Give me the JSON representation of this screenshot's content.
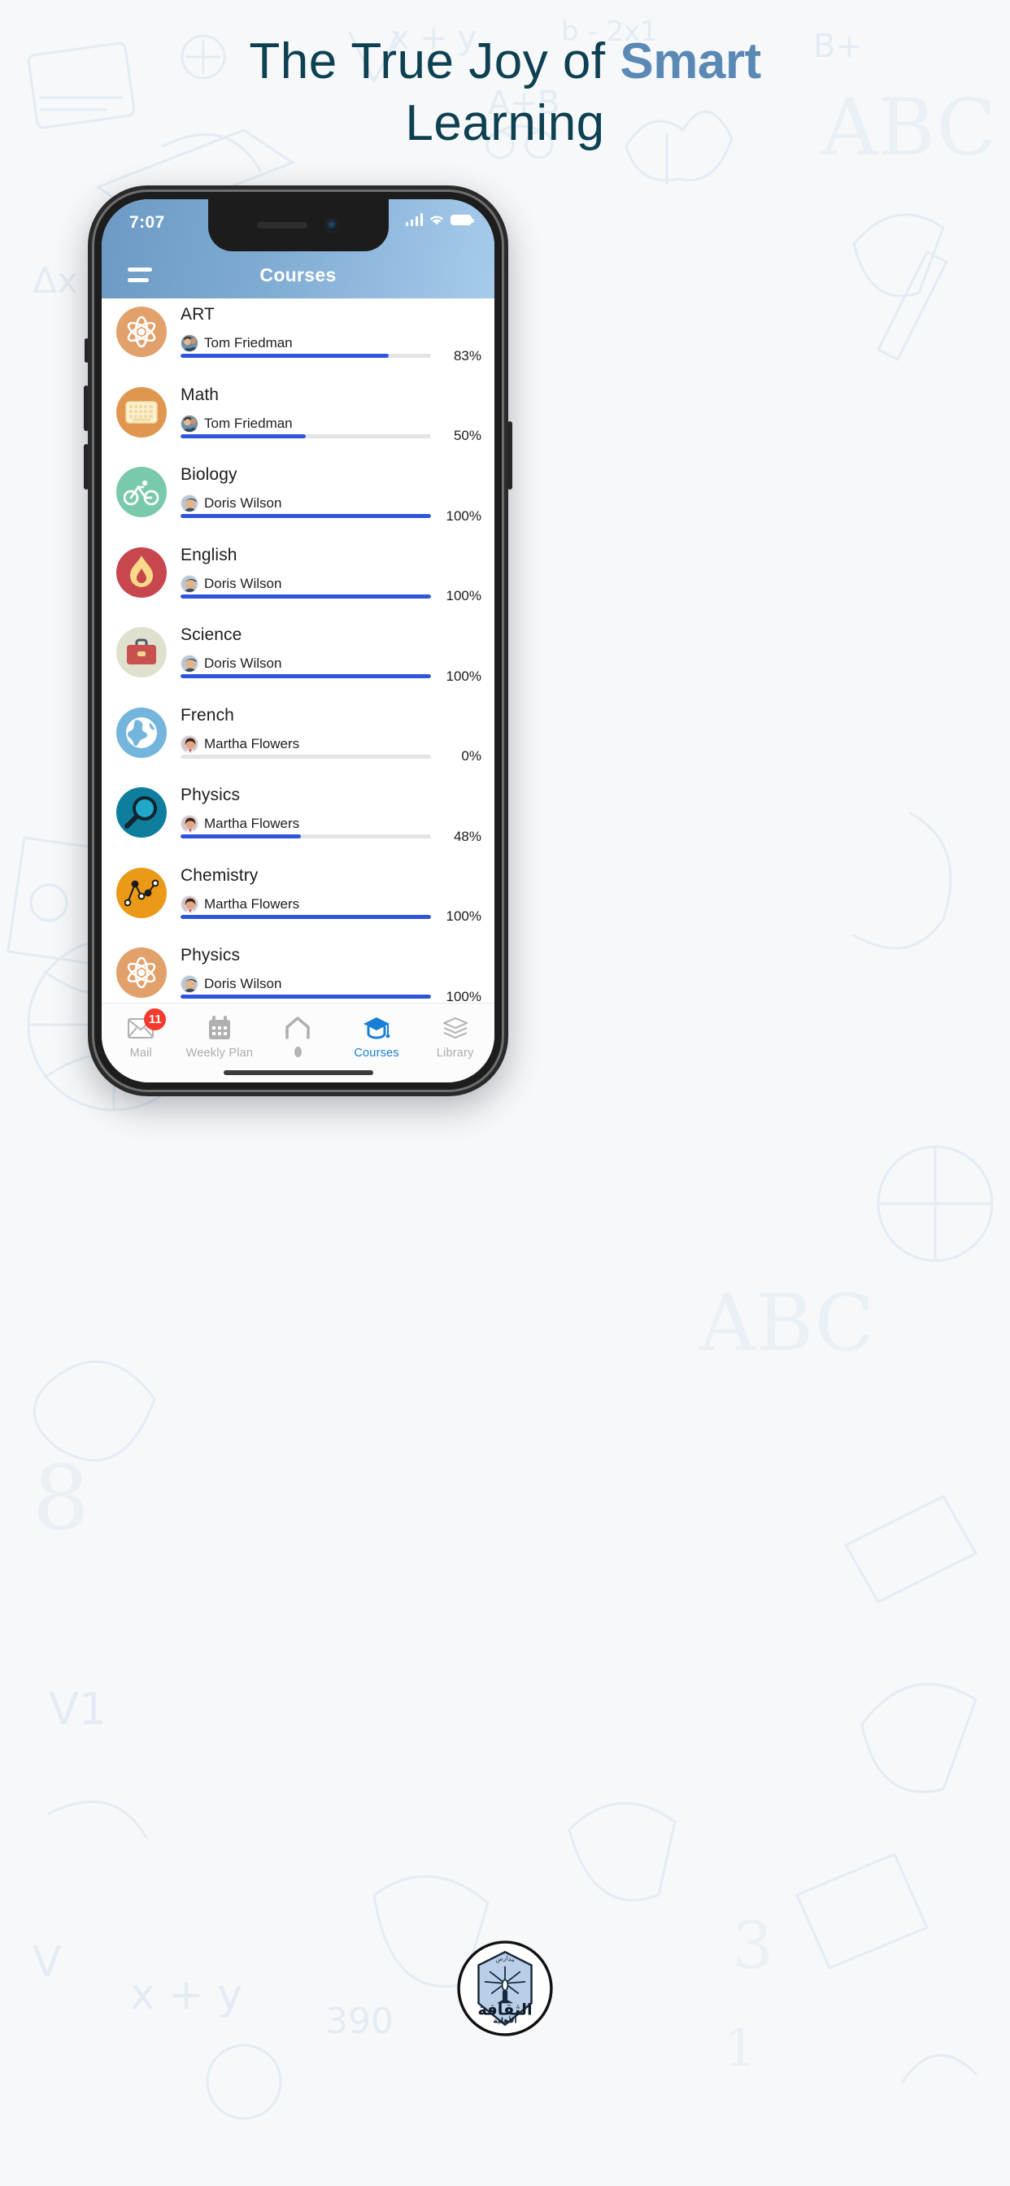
{
  "page": {
    "headline_part1": "The True Joy of ",
    "headline_accent": "Smart",
    "headline_part2": "Learning",
    "background": "#f7f8fa",
    "heading_color": "#0d4152",
    "accent_color": "#5b89b5"
  },
  "phone": {
    "status_bar": {
      "time": "7:07",
      "signal_icon": "cellular-signal-icon",
      "wifi_icon": "wifi-icon",
      "battery_icon": "battery-full-icon"
    },
    "nav_bar": {
      "menu_icon": "hamburger-menu-icon",
      "title": "Courses",
      "gradient_from": "#6c9ac4",
      "gradient_to": "#a6cbec"
    }
  },
  "courses": [
    {
      "title": "ART",
      "teacher": "Tom Friedman",
      "percent": 83,
      "percent_label": "83%",
      "icon": "atom-icon",
      "bg": "#e2a06a"
    },
    {
      "title": "Math",
      "teacher": "Tom Friedman",
      "percent": 50,
      "percent_label": "50%",
      "icon": "keyboard-icon",
      "bg": "#e0964f"
    },
    {
      "title": "Biology",
      "teacher": "Doris Wilson",
      "percent": 100,
      "percent_label": "100%",
      "icon": "bicycle-icon",
      "bg": "#79c9ab"
    },
    {
      "title": "English",
      "teacher": "Doris Wilson",
      "percent": 100,
      "percent_label": "100%",
      "icon": "flame-icon",
      "bg": "#c8464d"
    },
    {
      "title": "Science",
      "teacher": "Doris Wilson",
      "percent": 100,
      "percent_label": "100%",
      "icon": "briefcase-icon",
      "bg": "#dfe0ce"
    },
    {
      "title": "French",
      "teacher": "Martha Flowers",
      "percent": 0,
      "percent_label": "0%",
      "icon": "globe-icon",
      "bg": "#74b5dd"
    },
    {
      "title": "Physics",
      "teacher": "Martha Flowers",
      "percent": 48,
      "percent_label": "48%",
      "icon": "magnifier-icon",
      "bg": "#0f7e9e"
    },
    {
      "title": "Chemistry",
      "teacher": "Martha Flowers",
      "percent": 100,
      "percent_label": "100%",
      "icon": "line-chart-icon",
      "bg": "#eb9a18"
    },
    {
      "title": "Physics",
      "teacher": "Doris Wilson",
      "percent": 100,
      "percent_label": "100%",
      "icon": "atom-icon",
      "bg": "#e2a06a"
    }
  ],
  "progress": {
    "fill_color": "#3055d8",
    "track_color": "#e4e4e6"
  },
  "tabs": [
    {
      "label": "Mail",
      "icon": "mail-icon",
      "badge": "11",
      "active": false
    },
    {
      "label": "Weekly Plan",
      "icon": "calendar-icon",
      "badge": "",
      "active": false
    },
    {
      "label": "",
      "icon": "home-icon",
      "badge": "",
      "active": false
    },
    {
      "label": "Courses",
      "icon": "graduation-cap-icon",
      "badge": "",
      "active": true
    },
    {
      "label": "Library",
      "icon": "books-icon",
      "badge": "",
      "active": false
    }
  ],
  "tab_colors": {
    "active": "#1a7fd4",
    "inactive": "#adadad",
    "badge": "#f5392c"
  },
  "footer": {
    "logo": "school-crest-logo",
    "logo_text_main": "الثقافة",
    "logo_text_sub": "الأهلية"
  }
}
